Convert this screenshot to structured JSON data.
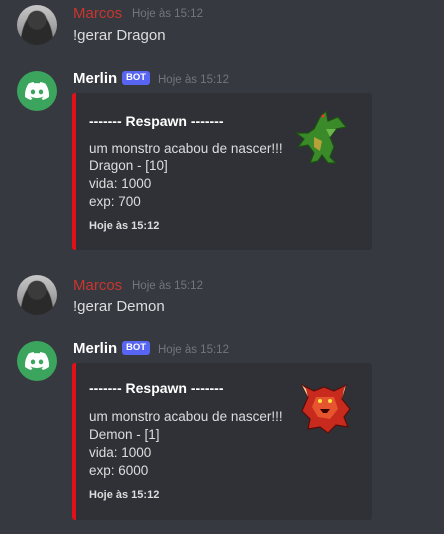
{
  "messages": [
    {
      "author": "Marcos",
      "timestamp": "Hoje às 15:12",
      "text": "!gerar Dragon"
    },
    {
      "author": "Merlin",
      "bot_tag": "BOT",
      "timestamp": "Hoje às 15:12",
      "embed": {
        "title": "------- Respawn -------",
        "lines": [
          "um monstro acabou de nascer!!!",
          "Dragon - [10]",
          "vida: 1000",
          "exp: 700"
        ],
        "footer": "Hoje às 15:12",
        "thumbnail_icon": "dragon-sprite",
        "accent_color": "#e3101a"
      }
    },
    {
      "author": "Marcos",
      "timestamp": "Hoje às 15:12",
      "text": "!gerar Demon"
    },
    {
      "author": "Merlin",
      "bot_tag": "BOT",
      "timestamp": "Hoje às 15:12",
      "embed": {
        "title": "------- Respawn -------",
        "lines": [
          "um monstro acabou de nascer!!!",
          "Demon - [1]",
          "vida: 1000",
          "exp: 6000"
        ],
        "footer": "Hoje às 15:12",
        "thumbnail_icon": "demon-sprite",
        "accent_color": "#e3101a"
      }
    }
  ],
  "colors": {
    "background": "#36393f",
    "embed_background": "#2f3136",
    "user_name": "#c9362f",
    "bot_avatar": "#3ba55d",
    "bot_tag": "#5865f2"
  }
}
